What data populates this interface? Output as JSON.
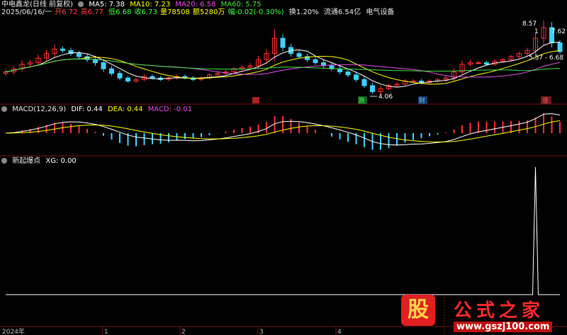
{
  "header": {
    "stock": "中电鑫龙(日线 前复权)",
    "ma": [
      {
        "label": "MA5: 7.38",
        "color": "#ffffff"
      },
      {
        "label": "MA10: 7.23",
        "color": "#ffff00"
      },
      {
        "label": "MA20: 6.58",
        "color": "#e050e0"
      },
      {
        "label": "MA60: 5.75",
        "color": "#40e040"
      }
    ]
  },
  "quote": {
    "date": "2025/06/16/一",
    "open": "开6.72",
    "high": "高6.77",
    "low": "低6.68",
    "close": "收6.73",
    "volume": "量78508",
    "amount": "额5280万",
    "change": "幅-0.02(-0.30%)",
    "turnover": "换1.20%",
    "float": "流通6.54亿",
    "sector": "电气设备"
  },
  "macd_panel": {
    "name": "MACD(12,26,9)",
    "dif": "DIF: 0.44",
    "dea": "DEA: 0.44",
    "macd": "MACD: -0.01"
  },
  "xg_panel": {
    "name": "新起爆点",
    "xg": "XG: 0.00"
  },
  "annotations": {
    "high_label": "8.57",
    "tag1": "1",
    "tag2": "7.62",
    "range_label": "5.57 - 6.68",
    "low_label": "4.06"
  },
  "events": {
    "e1": "跌",
    "e2": "财",
    "e3": "涨"
  },
  "time_axis": {
    "year": "2024年",
    "m1": "1",
    "m2": "2",
    "m3": "3",
    "m4": "4"
  },
  "watermark": {
    "logo": "股",
    "title": "公式之家",
    "url": "www.gszj100.com"
  },
  "colors": {
    "up": "#ff3030",
    "down": "#40d0ff",
    "ma5": "#ffffff",
    "ma10": "#ffff00",
    "ma20": "#e050e0",
    "ma60": "#40e040",
    "dif": "#ffffff",
    "dea": "#ffff00",
    "xg": "#ffffff"
  },
  "chart_data": [
    {
      "type": "candlestick",
      "title": "中电鑫龙(日线 前复权)",
      "close": [
        5.4,
        5.6,
        5.9,
        6.0,
        6.3,
        6.6,
        6.9,
        6.8,
        6.6,
        6.4,
        6.2,
        6.0,
        5.6,
        5.3,
        5.0,
        4.8,
        4.9,
        5.1,
        5.0,
        4.9,
        5.0,
        5.1,
        5.0,
        4.9,
        5.0,
        5.2,
        5.3,
        5.4,
        5.6,
        5.7,
        5.8,
        6.2,
        6.6,
        7.6,
        7.0,
        6.6,
        6.4,
        6.2,
        6.0,
        5.8,
        5.6,
        5.4,
        5.2,
        4.9,
        4.5,
        4.1,
        4.3,
        4.5,
        4.6,
        4.8,
        4.8,
        4.7,
        4.8,
        4.9,
        5.0,
        5.4,
        5.9,
        6.0,
        6.0,
        5.9,
        6.1,
        6.2,
        6.4,
        6.6,
        6.8,
        7.6,
        8.3,
        7.3,
        6.73
      ],
      "volatility": [
        0.3,
        0.3,
        0.4,
        0.3,
        0.4,
        0.4,
        0.5,
        0.3,
        0.3,
        0.3,
        0.3,
        0.4,
        0.4,
        0.3,
        0.3,
        0.2,
        0.2,
        0.2,
        0.2,
        0.2,
        0.2,
        0.2,
        0.2,
        0.2,
        0.2,
        0.2,
        0.2,
        0.2,
        0.2,
        0.2,
        0.3,
        0.4,
        0.5,
        1.0,
        0.5,
        0.4,
        0.3,
        0.3,
        0.3,
        0.3,
        0.3,
        0.3,
        0.3,
        0.3,
        0.3,
        0.3,
        0.3,
        0.2,
        0.2,
        0.2,
        0.2,
        0.2,
        0.2,
        0.2,
        0.3,
        0.4,
        0.4,
        0.3,
        0.2,
        0.2,
        0.2,
        0.2,
        0.2,
        0.2,
        0.3,
        0.6,
        0.8,
        0.6,
        0.3
      ],
      "ylim": [
        3.8,
        8.9
      ],
      "high": 8.57,
      "low": 4.06,
      "last": 6.73
    },
    {
      "type": "line",
      "title": "MACD(12,26,9)",
      "series": [
        {
          "name": "DIF"
        },
        {
          "name": "DEA"
        },
        {
          "name": "MACD"
        }
      ],
      "dif": 0.44,
      "dea": 0.44,
      "macd": -0.01
    },
    {
      "type": "line",
      "title": "新起爆点",
      "series": [
        {
          "name": "XG",
          "values": [
            0,
            0,
            0,
            0,
            0,
            0,
            0,
            0,
            0,
            0,
            0,
            0,
            0,
            0,
            0,
            0,
            0,
            0,
            0,
            0,
            0,
            0,
            0,
            0,
            0,
            0,
            0,
            0,
            0,
            0,
            0,
            0,
            0,
            0,
            0,
            0,
            0,
            0,
            0,
            0,
            0,
            0,
            0,
            0,
            0,
            0,
            0,
            0,
            0,
            0,
            0,
            0,
            0,
            0,
            0,
            0,
            0,
            0,
            0,
            0,
            0,
            0,
            0,
            0,
            0,
            1,
            0,
            0,
            0
          ]
        }
      ]
    }
  ]
}
